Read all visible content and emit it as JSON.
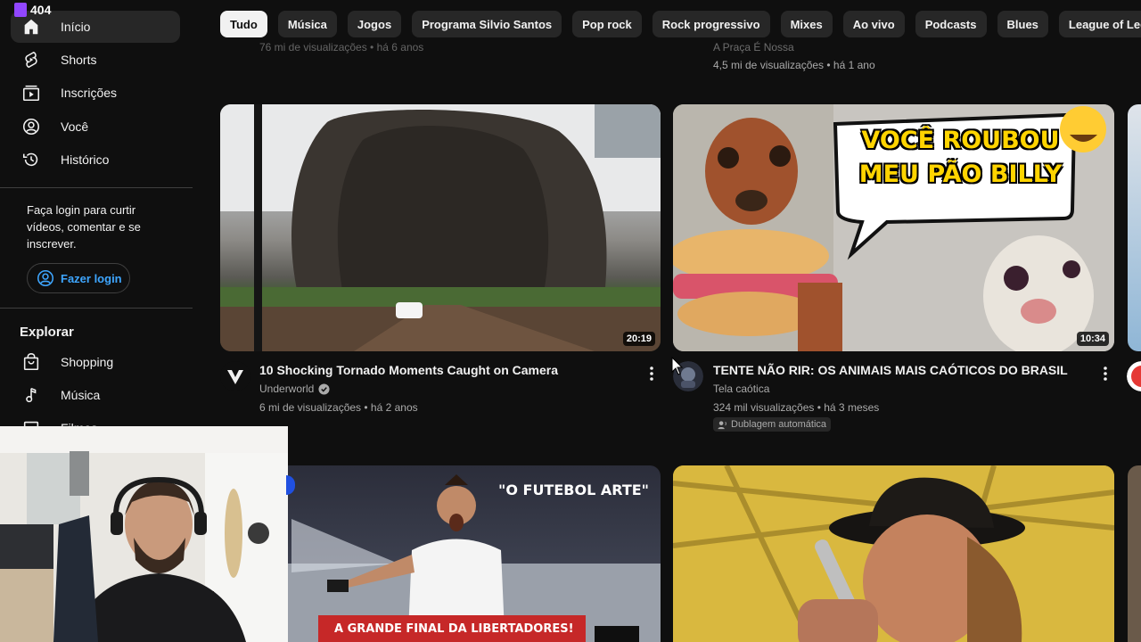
{
  "overlay": {
    "badge": "404"
  },
  "sidebar": {
    "items": [
      {
        "label": "Início"
      },
      {
        "label": "Shorts"
      },
      {
        "label": "Inscrições"
      },
      {
        "label": "Você"
      },
      {
        "label": "Histórico"
      }
    ],
    "login_prompt": "Faça login para curtir vídeos, comentar e se inscrever.",
    "login_button": "Fazer login",
    "explore_title": "Explorar",
    "explore_items": [
      {
        "label": "Shopping"
      },
      {
        "label": "Música"
      },
      {
        "label": "Filmes"
      }
    ]
  },
  "chips": [
    "Tudo",
    "Música",
    "Jogos",
    "Programa Silvio Santos",
    "Pop rock",
    "Rock progressivo",
    "Mixes",
    "Ao vivo",
    "Podcasts",
    "Blues",
    "League of Legends C"
  ],
  "top_partial": {
    "left_stats": "76 mi de visualizações • há 6 anos",
    "right_channel": "A Praça É Nossa",
    "right_stats": "4,5 mi de visualizações • há 1 ano"
  },
  "videos": [
    {
      "title": "10 Shocking Tornado Moments Caught on Camera",
      "channel": "Underworld",
      "stats": "6 mi de visualizações • há 2 anos",
      "duration": "20:19"
    },
    {
      "title": "TENTE NÃO RIR: OS ANIMAIS MAIS CAÓTICOS DO BRASIL",
      "channel": "Tela caótica",
      "stats": "324 mil visualizações • há 3 meses",
      "duration": "10:34",
      "badge": "Dublagem automática",
      "thumb_text": "VOCÊ ROUBOU MEU PÃO BILLY"
    }
  ],
  "bottom_thumbs": {
    "futebol_title": "\"O FUTEBOL ARTE\"",
    "futebol_banner": "A GRANDE FINAL DA LIBERTADORES!"
  },
  "colors": {
    "bg": "#0f0f0f",
    "chip": "#272727",
    "link": "#3ea6ff",
    "muted": "#aaaaaa"
  }
}
